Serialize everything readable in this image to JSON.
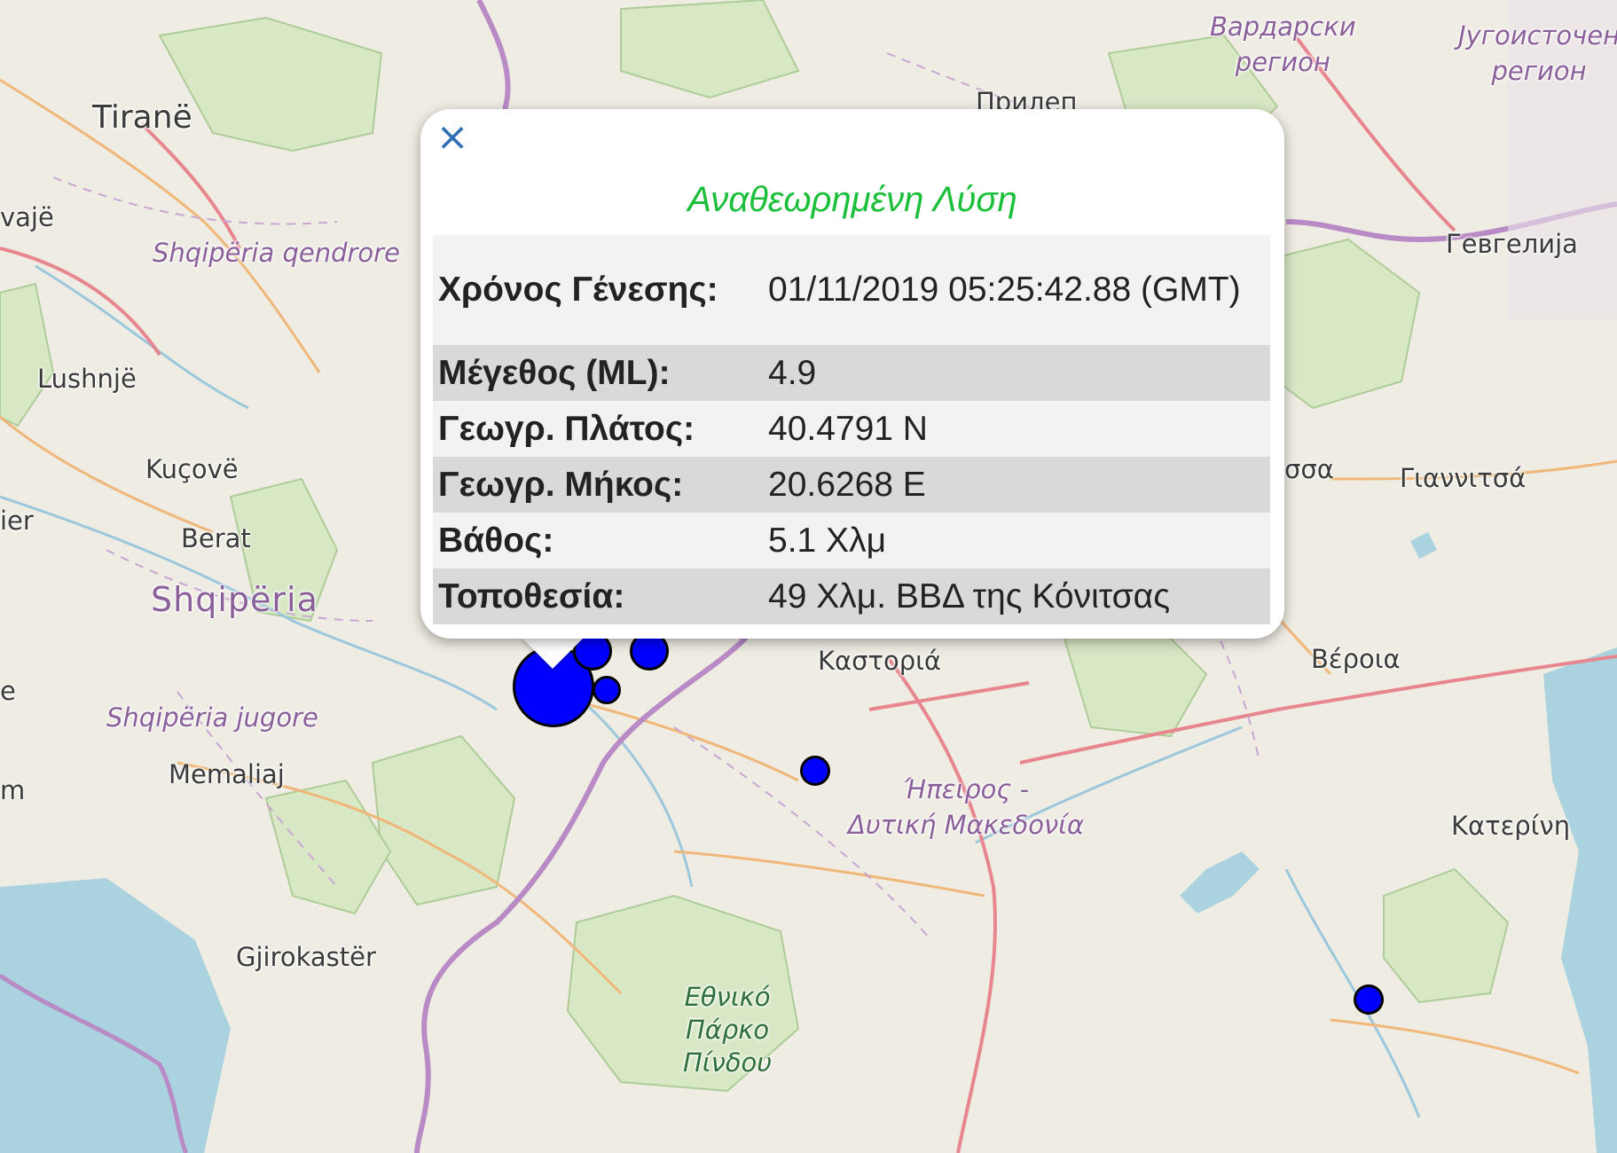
{
  "map": {
    "labels": {
      "tirane": "Tiranë",
      "vaje": "vajë",
      "shqiperia_qendrore": "Shqipëria qendrore",
      "lushnje": "Lushnjë",
      "kucove": "Kuçovë",
      "fier": "ier",
      "berat": "Berat",
      "shqiperia": "Shqipëria",
      "e_fragment": "e",
      "shqiperia_jugore": "Shqipëria jugore",
      "memaliaj": "Memaliaj",
      "m_fragment": "m",
      "gjirokaster": "Gjirokastër",
      "vardarski": "Вардарски\nрегион",
      "jugoistocen": "Југоисточен\nрегион",
      "prilep": "Прилеп",
      "gevgelija": "Гевгелија",
      "edessa_fragment": "σσα",
      "giannitsa": "Γιαννιτσά",
      "kastoria": "Καστοριά",
      "veroia": "Βέροια",
      "ipeiros": "Ήπειρος -\nΔυτική Μακεδονία",
      "katerini": "Κατερίνη",
      "pindus_park": "Εθνικό\nΠάρκο\nΠίνδου"
    },
    "quake_markers_count_visible": 7
  },
  "popup": {
    "close_icon": "close-icon",
    "close_glyph": "×",
    "title": "Αναθεωρημένη Λύση",
    "title_color": "#1bbf3a",
    "rows": [
      {
        "key": "Χρόνος Γένεσης:",
        "value": "01/11/2019 05:25:42.88 (GMT)"
      },
      {
        "key": "Μέγεθος (ML):",
        "value": "4.9"
      },
      {
        "key": "Γεωγρ. Πλάτος:",
        "value": "40.4791 N"
      },
      {
        "key": "Γεωγρ. Μήκος:",
        "value": "20.6268 E"
      },
      {
        "key": "Βάθος:",
        "value": "5.1 Χλμ"
      },
      {
        "key": "Τοποθεσία:",
        "value": "49 Χλμ. ΒΒΔ της Κόνιτσας"
      }
    ]
  },
  "colors": {
    "marker_fill": "#0000ff",
    "border_purple": "#b98bc6",
    "road_red": "#e8868f",
    "road_orange": "#f0b77a",
    "water": "#aad3df",
    "forest": "#cfe3b8"
  }
}
